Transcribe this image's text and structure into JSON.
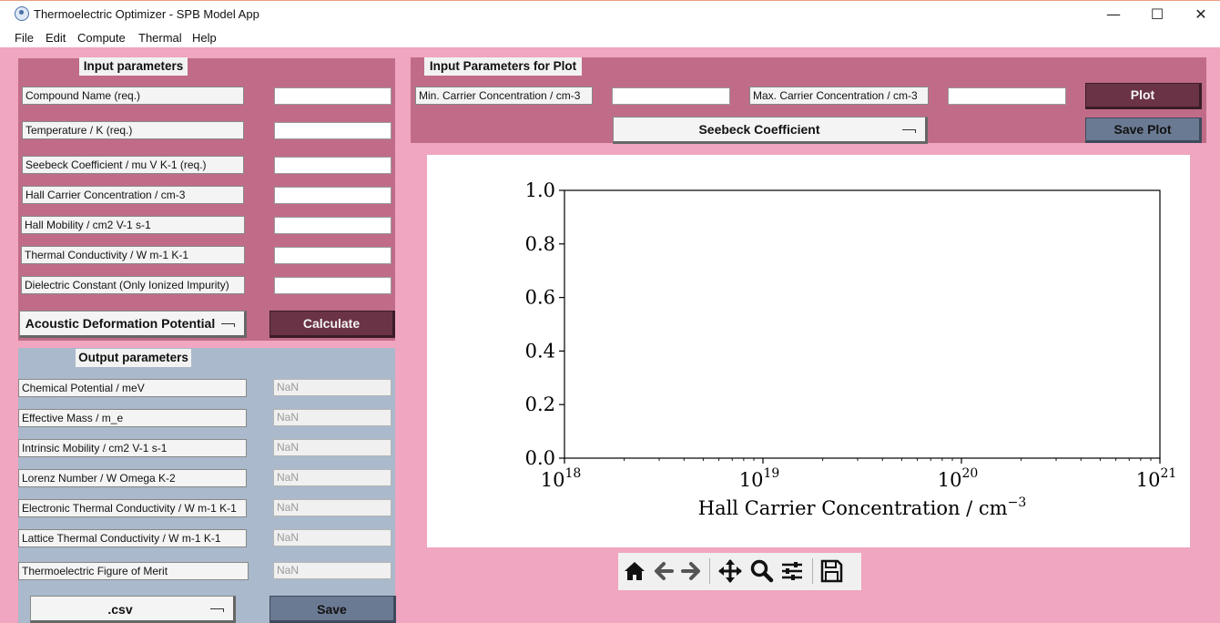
{
  "window": {
    "title": "Thermoelectric Optimizer - SPB Model App",
    "controls": {
      "minimize": "—",
      "maximize": "☐",
      "close": "✕"
    }
  },
  "menu": [
    "File",
    "Edit",
    "Compute",
    "Thermal",
    "Help"
  ],
  "input_panel": {
    "heading": "Input parameters",
    "fields": [
      {
        "label": "Compound Name (req.)",
        "value": ""
      },
      {
        "label": "Temperature / K (req.)",
        "value": ""
      },
      {
        "label": "Seebeck Coefficient / mu V K-1 (req.)",
        "value": ""
      },
      {
        "label": "Hall Carrier Concentration / cm-3",
        "value": ""
      },
      {
        "label": "Hall Mobility / cm2 V-1 s-1",
        "value": ""
      },
      {
        "label": "Thermal Conductivity / W m-1 K-1",
        "value": ""
      },
      {
        "label": "Dielectric Constant (Only Ionized Impurity)",
        "value": ""
      }
    ],
    "scattering_select": "Acoustic Deformation Potential",
    "calculate_label": "Calculate"
  },
  "output_panel": {
    "heading": "Output parameters",
    "fields": [
      {
        "label": "Chemical Potential / meV",
        "value": "NaN"
      },
      {
        "label": "Effective Mass / m_e",
        "value": "NaN"
      },
      {
        "label": "Intrinsic Mobility / cm2 V-1 s-1",
        "value": "NaN"
      },
      {
        "label": "Lorenz Number / W Omega K-2",
        "value": "NaN"
      },
      {
        "label": "Electronic Thermal Conductivity / W m-1 K-1",
        "value": "NaN"
      },
      {
        "label": "Lattice Thermal Conductivity / W m-1 K-1",
        "value": "NaN"
      },
      {
        "label": "Thermoelectric Figure of Merit",
        "value": "NaN"
      }
    ],
    "format_select": ".csv",
    "save_label": "Save"
  },
  "plot_panel": {
    "heading": "Input Parameters for Plot",
    "min_label": "Min. Carrier Concentration / cm-3",
    "min_value": "",
    "max_label": "Max. Carrier Concentration / cm-3",
    "max_value": "",
    "quantity_select": "Seebeck Coefficient",
    "plot_label": "Plot",
    "save_plot_label": "Save Plot"
  },
  "chart_data": {
    "type": "line",
    "series": [],
    "xlabel": "Hall Carrier Concentration / cm",
    "xlabel_exponent": "−3",
    "xscale": "log",
    "xlim": [
      1e+18,
      1e+21
    ],
    "x_ticks": [
      {
        "base": "10",
        "exp": "18"
      },
      {
        "base": "10",
        "exp": "19"
      },
      {
        "base": "10",
        "exp": "20"
      },
      {
        "base": "10",
        "exp": "21"
      }
    ],
    "ylim": [
      0,
      1
    ],
    "y_ticks": [
      "0.0",
      "0.2",
      "0.4",
      "0.6",
      "0.8",
      "1.0"
    ],
    "grid": false
  },
  "toolbar": [
    "home-icon",
    "back-icon",
    "forward-icon",
    "pan-icon",
    "zoom-icon",
    "configure-subplots-icon",
    "save-figure-icon"
  ]
}
